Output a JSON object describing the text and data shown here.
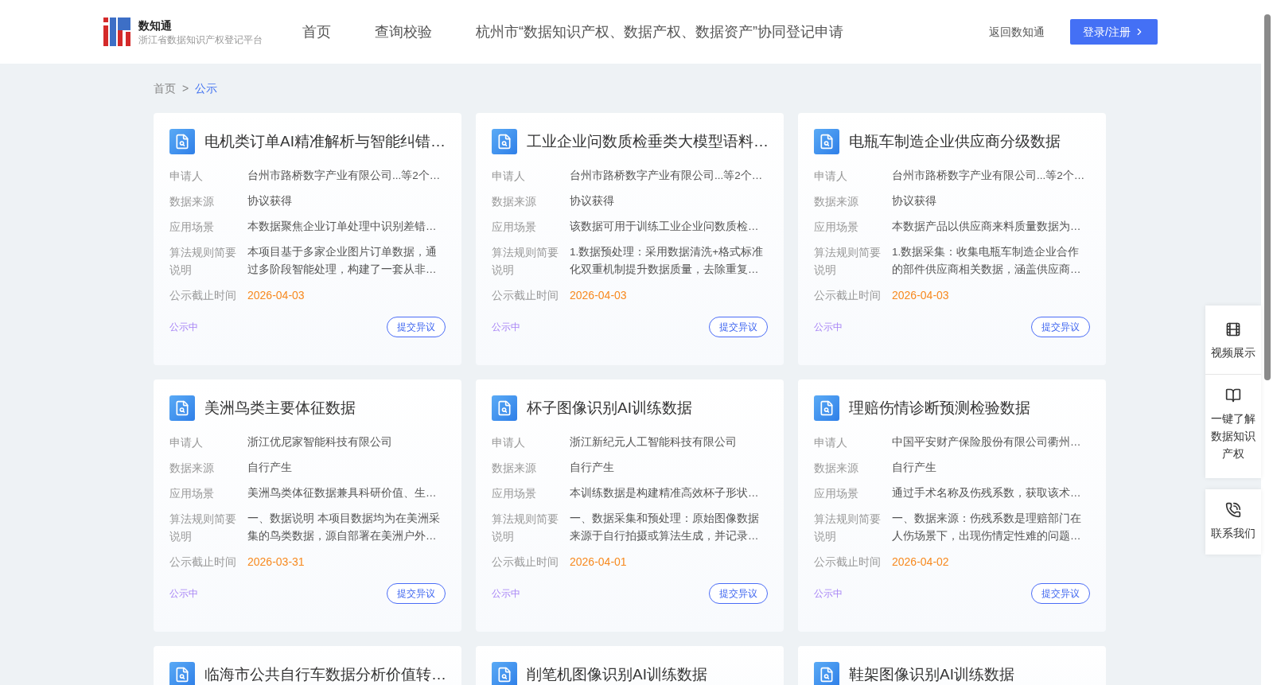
{
  "header": {
    "logo_title": "数知通",
    "logo_subtitle": "浙江省数据知识产权登记平台",
    "nav": [
      {
        "label": "首页"
      },
      {
        "label": "查询校验"
      },
      {
        "label": "杭州市“数据知识产权、数据产权、数据资产”协同登记申请"
      }
    ],
    "back_link": "返回数知通",
    "login_button": "登录/注册"
  },
  "breadcrumb": [
    {
      "label": "首页",
      "current": false
    },
    {
      "label": "公示",
      "current": true
    }
  ],
  "breadcrumb_separator": ">",
  "cards": [
    {
      "title": "电机类订单AI精准解析与智能纠错…",
      "fields": [
        {
          "label": "申请人",
          "value": "台州市路桥数字产业有限公司...等2个…"
        },
        {
          "label": "数据来源",
          "value": "协议获得"
        },
        {
          "label": "应用场景",
          "value": "本数据聚焦企业订单处理中识别差错…"
        },
        {
          "label": "算法规则简要说明",
          "value": "本项目基于多家企业图片订单数据，通过多阶段智能处理，构建了一套从非…"
        }
      ],
      "deadline_label": "公示截止时间",
      "deadline": "2026-04-03",
      "status": "公示中",
      "action": "提交异议"
    },
    {
      "title": "工业企业问数质检垂类大模型语料…",
      "fields": [
        {
          "label": "申请人",
          "value": "台州市路桥数字产业有限公司...等2个…"
        },
        {
          "label": "数据来源",
          "value": "协议获得"
        },
        {
          "label": "应用场景",
          "value": "该数据可用于训练工业企业问数质检…"
        },
        {
          "label": "算法规则简要说明",
          "value": "1.数据预处理：采用数据清洗+格式标准化双重机制提升数据质量，去除重复…"
        }
      ],
      "deadline_label": "公示截止时间",
      "deadline": "2026-04-03",
      "status": "公示中",
      "action": "提交异议"
    },
    {
      "title": "电瓶车制造企业供应商分级数据",
      "fields": [
        {
          "label": "申请人",
          "value": "台州市路桥数字产业有限公司...等2个…"
        },
        {
          "label": "数据来源",
          "value": "协议获得"
        },
        {
          "label": "应用场景",
          "value": "本数据产品以供应商来料质量数据为…"
        },
        {
          "label": "算法规则简要说明",
          "value": "1.数据采集：收集电瓶车制造企业合作的部件供应商相关数据，涵盖供应商…"
        }
      ],
      "deadline_label": "公示截止时间",
      "deadline": "2026-04-03",
      "status": "公示中",
      "action": "提交异议"
    },
    {
      "title": "美洲鸟类主要体征数据",
      "fields": [
        {
          "label": "申请人",
          "value": "浙江优尼家智能科技有限公司"
        },
        {
          "label": "数据来源",
          "value": "自行产生"
        },
        {
          "label": "应用场景",
          "value": "美洲鸟类体征数据兼具科研价值、生…"
        },
        {
          "label": "算法规则简要说明",
          "value": "一、数据说明 本项目数据均为在美洲采集的鸟类数据，源自部署在美洲户外…"
        }
      ],
      "deadline_label": "公示截止时间",
      "deadline": "2026-03-31",
      "status": "公示中",
      "action": "提交异议"
    },
    {
      "title": "杯子图像识别AI训练数据",
      "fields": [
        {
          "label": "申请人",
          "value": "浙江新纪元人工智能科技有限公司"
        },
        {
          "label": "数据来源",
          "value": "自行产生"
        },
        {
          "label": "应用场景",
          "value": "本训练数据是构建精准高效杯子形状…"
        },
        {
          "label": "算法规则简要说明",
          "value": "一、数据采集和预处理：原始图像数据来源于自行拍摄或算法生成，并记录…"
        }
      ],
      "deadline_label": "公示截止时间",
      "deadline": "2026-04-01",
      "status": "公示中",
      "action": "提交异议"
    },
    {
      "title": "理赔伤情诊断预测检验数据",
      "fields": [
        {
          "label": "申请人",
          "value": "中国平安财产保险股份有限公司衢州…"
        },
        {
          "label": "数据来源",
          "value": "自行产生"
        },
        {
          "label": "应用场景",
          "value": "通过手术名称及伤残系数，获取该术…"
        },
        {
          "label": "算法规则简要说明",
          "value": "一、数据来源：伤残系数是理赔部门在人伤场景下，出现伤情定性难的问题…"
        }
      ],
      "deadline_label": "公示截止时间",
      "deadline": "2026-04-02",
      "status": "公示中",
      "action": "提交异议"
    },
    {
      "title": "临海市公共自行车数据分析价值转…"
    },
    {
      "title": "削笔机图像识别AI训练数据"
    },
    {
      "title": "鞋架图像识别AI训练数据"
    }
  ],
  "side_panel": [
    {
      "kind": "video",
      "label": "视频展示"
    },
    {
      "kind": "book",
      "label": "一键了解数据知识产权"
    },
    {
      "kind": "phone",
      "label": "联系我们"
    }
  ]
}
